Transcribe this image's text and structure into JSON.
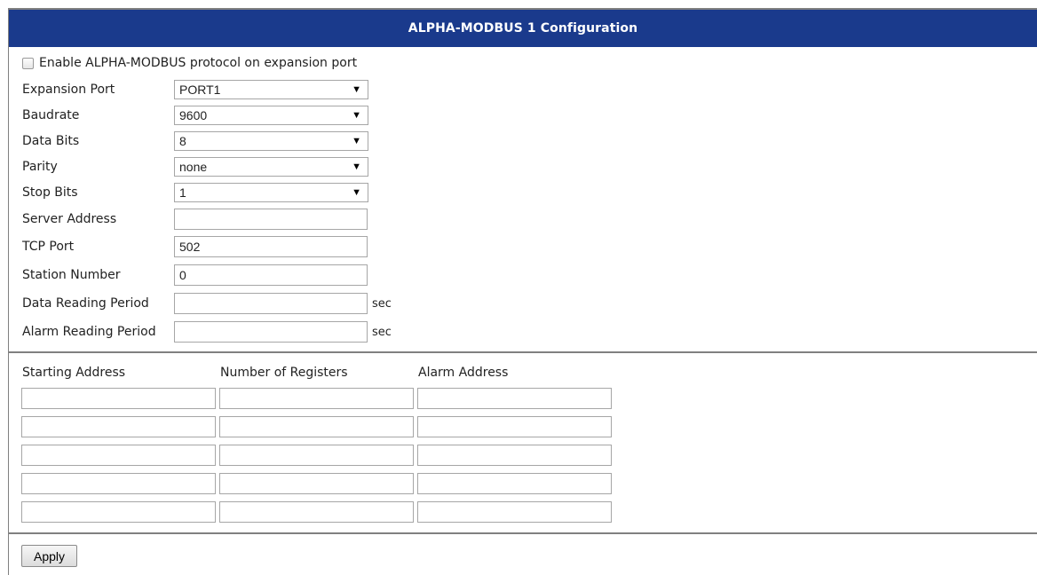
{
  "header": {
    "title": "ALPHA-MODBUS 1 Configuration"
  },
  "enable": {
    "label": "Enable ALPHA-MODBUS protocol on expansion port",
    "checked": false
  },
  "fields": {
    "expansion_port": {
      "label": "Expansion Port",
      "value": "PORT1"
    },
    "baudrate": {
      "label": "Baudrate",
      "value": "9600"
    },
    "data_bits": {
      "label": "Data Bits",
      "value": "8"
    },
    "parity": {
      "label": "Parity",
      "value": "none"
    },
    "stop_bits": {
      "label": "Stop Bits",
      "value": "1"
    },
    "server_address": {
      "label": "Server Address",
      "value": ""
    },
    "tcp_port": {
      "label": "TCP Port",
      "value": "502"
    },
    "station_number": {
      "label": "Station Number",
      "value": "0"
    },
    "data_reading_period": {
      "label": "Data Reading Period",
      "value": "",
      "unit": "sec"
    },
    "alarm_reading_period": {
      "label": "Alarm Reading Period",
      "value": "",
      "unit": "sec"
    }
  },
  "registers": {
    "columns": [
      "Starting Address",
      "Number of Registers",
      "Alarm Address"
    ],
    "rows": [
      [
        "",
        "",
        ""
      ],
      [
        "",
        "",
        ""
      ],
      [
        "",
        "",
        ""
      ],
      [
        "",
        "",
        ""
      ],
      [
        "",
        "",
        ""
      ]
    ]
  },
  "actions": {
    "apply_label": "Apply"
  }
}
